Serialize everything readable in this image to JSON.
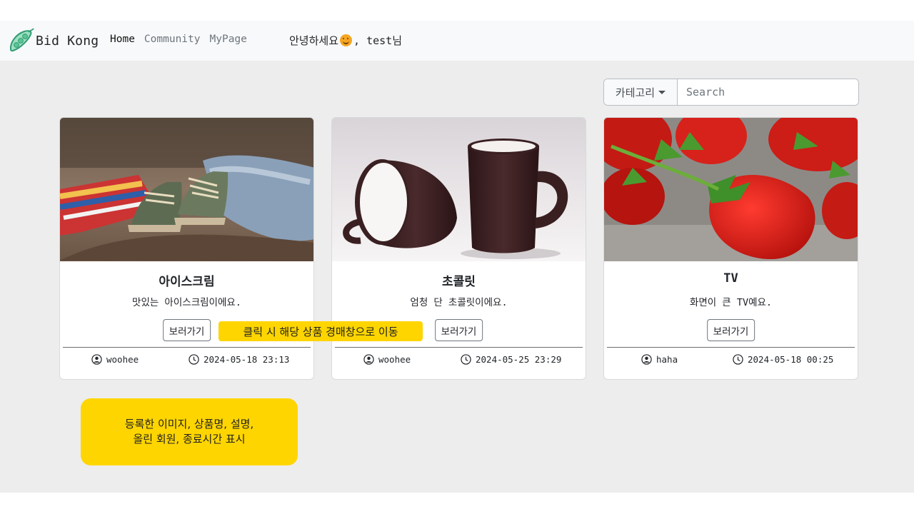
{
  "brand": {
    "name": "Bid Kong",
    "logo_icon": "peapod-icon"
  },
  "nav": {
    "links": [
      {
        "label": "Home"
      },
      {
        "label": "Community"
      },
      {
        "label": "MyPage"
      }
    ],
    "greeting_prefix": "안녕하세요",
    "greeting_suffix": ", test님"
  },
  "search": {
    "category_label": "카테고리",
    "placeholder": "Search"
  },
  "cards": [
    {
      "image_icon": "baby-shoes-photo",
      "title": "아이스크림",
      "description": "맛있는 아이스크림이에요.",
      "button_label": "보러가기",
      "user": "woohee",
      "end_time": "2024-05-18 23:13"
    },
    {
      "image_icon": "coffee-mugs-photo",
      "title": "초콜릿",
      "description": "엄청 단 초콜릿이에요.",
      "button_label": "보러가기",
      "user": "woohee",
      "end_time": "2024-05-25 23:29"
    },
    {
      "image_icon": "strawberries-photo",
      "title": "TV",
      "description": "화면이 큰 TV예요.",
      "button_label": "보러가기",
      "user": "haha",
      "end_time": "2024-05-18 00:25"
    }
  ],
  "annotations": {
    "button_note": "클릭 시 해당 상품 경매창으로 이동",
    "card_note_line1": "등록한 이미지, 상품명, 설명,",
    "card_note_line2": "올린 회원, 종료시간 표시",
    "color": "#ffd500"
  },
  "colors": {
    "navbar_bg": "#f8f9fa",
    "page_bg": "#ededed",
    "logo_green": "#3aa37a"
  }
}
